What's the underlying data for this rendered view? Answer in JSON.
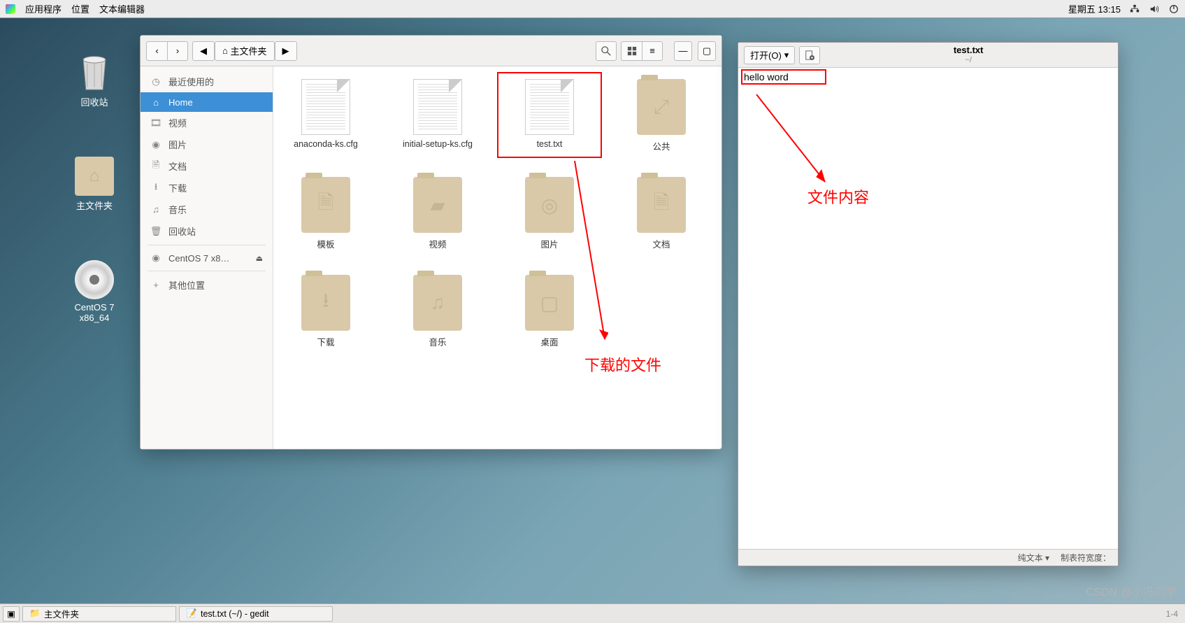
{
  "topbar": {
    "menus": [
      "应用程序",
      "位置",
      "文本编辑器"
    ],
    "datetime": "星期五 13:15"
  },
  "desktop": {
    "trash": "回收站",
    "home": "主文件夹",
    "disc": "CentOS 7 x86_64"
  },
  "fileManager": {
    "pathLabel": "主文件夹",
    "homeIcon": "⌂",
    "sidebar": {
      "recent": "最近使用的",
      "home": "Home",
      "videos": "视频",
      "pictures": "图片",
      "documents": "文档",
      "downloads": "下载",
      "music": "音乐",
      "trash": "回收站",
      "disc": "CentOS 7 x8…",
      "other": "其他位置"
    },
    "files": [
      {
        "name": "anaconda-ks.cfg",
        "type": "doc"
      },
      {
        "name": "initial-setup-ks.cfg",
        "type": "doc"
      },
      {
        "name": "test.txt",
        "type": "doc",
        "highlight": true
      },
      {
        "name": "公共",
        "type": "folder",
        "glyph": "⤢"
      },
      {
        "name": "模板",
        "type": "folder",
        "glyph": "🗎"
      },
      {
        "name": "视频",
        "type": "folder",
        "glyph": "▰"
      },
      {
        "name": "图片",
        "type": "folder",
        "glyph": "◎"
      },
      {
        "name": "文档",
        "type": "folder",
        "glyph": "🗎"
      },
      {
        "name": "下载",
        "type": "folder",
        "glyph": "⭳"
      },
      {
        "name": "音乐",
        "type": "folder",
        "glyph": "♫"
      },
      {
        "name": "桌面",
        "type": "folder",
        "glyph": "▢"
      }
    ]
  },
  "gedit": {
    "openLabel": "打开(O)",
    "title": "test.txt",
    "subtitle": "~/",
    "content": "hello word",
    "status": {
      "type": "纯文本 ▾",
      "tab": "制表符宽度："
    }
  },
  "annotations": {
    "fileContent": "文件内容",
    "downloadedFile": "下载的文件"
  },
  "taskbar": {
    "items": [
      "主文件夹",
      "test.txt (~/) - gedit"
    ]
  },
  "watermark": "CSDN @小冯同学",
  "cornerTag": "1-4"
}
